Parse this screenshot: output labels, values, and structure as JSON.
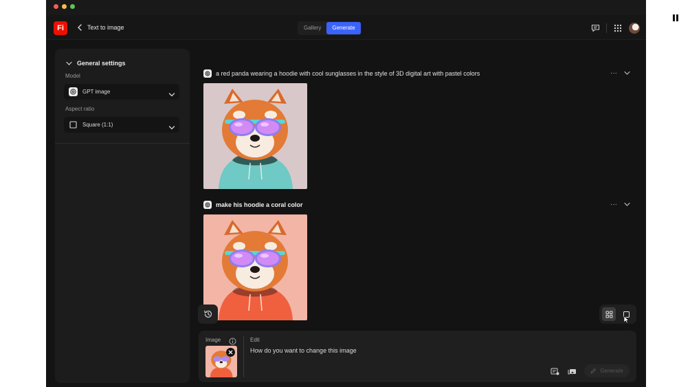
{
  "app": {
    "logo_text": "Fi",
    "title": "Text to image",
    "tabs": [
      {
        "label": "Gallery",
        "active": false
      },
      {
        "label": "Generate",
        "active": true
      }
    ],
    "header_icons": [
      "chat-icon",
      "apps-grid-icon",
      "avatar"
    ]
  },
  "sidebar": {
    "section_title": "General settings",
    "model_label": "Model",
    "model_value": "GPT image",
    "aspect_label": "Aspect ratio",
    "aspect_value": "Square (1:1)"
  },
  "feed": [
    {
      "prompt": "a red panda wearing a hoodie with cool sunglasses in the style of 3D digital art with pastel colors",
      "hoodie_color": "#6fc9c4",
      "background_color": "#d8c8c9"
    },
    {
      "prompt": "make his hoodie a coral color",
      "hoodie_color": "#f0603f",
      "background_color": "#f2b5a6"
    }
  ],
  "composer": {
    "image_label": "Image",
    "edit_label": "Edit",
    "placeholder": "How do you want to change this image",
    "generate_label": "Generate"
  },
  "colors": {
    "accent": "#3b63fb",
    "brand": "#eb1000",
    "background": "#131313",
    "panel": "#1c1c1c"
  }
}
